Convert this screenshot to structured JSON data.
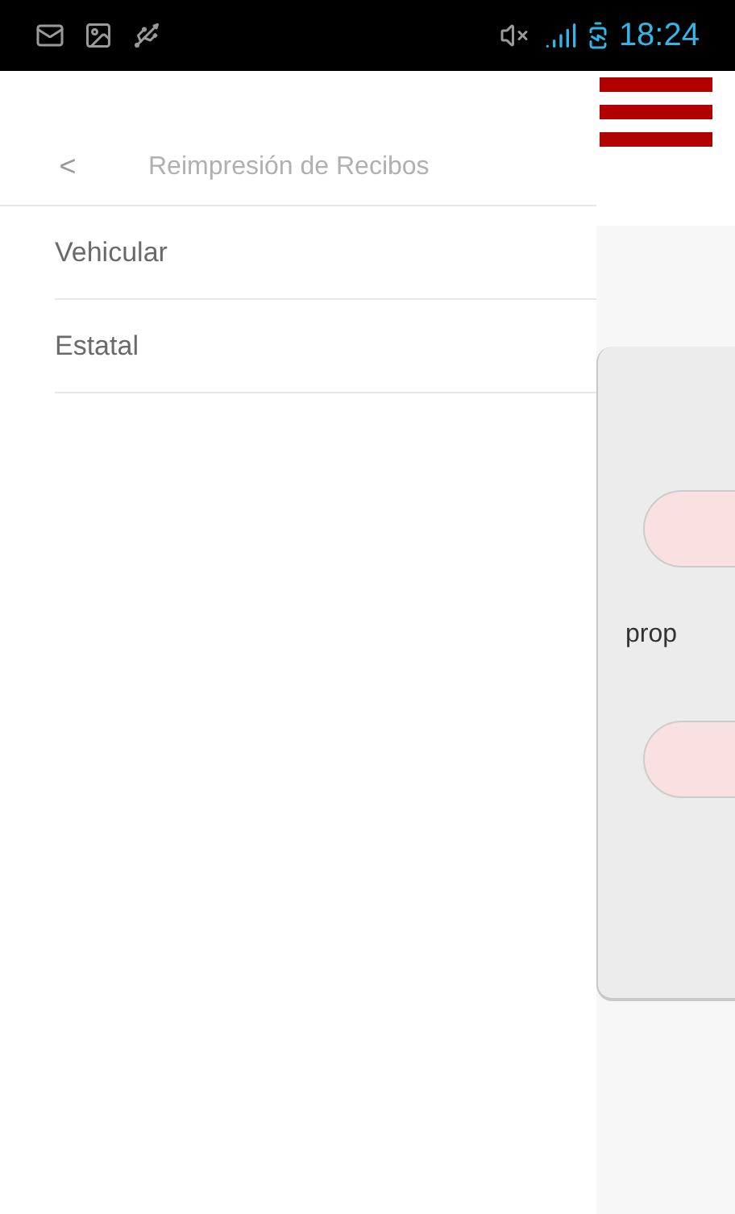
{
  "status_bar": {
    "time": "18:24"
  },
  "drawer": {
    "title": "Reimpresión de Recibos",
    "back": "<",
    "items": [
      {
        "label": "Vehicular"
      },
      {
        "label": "Estatal"
      }
    ]
  },
  "card": {
    "text": "prop"
  }
}
